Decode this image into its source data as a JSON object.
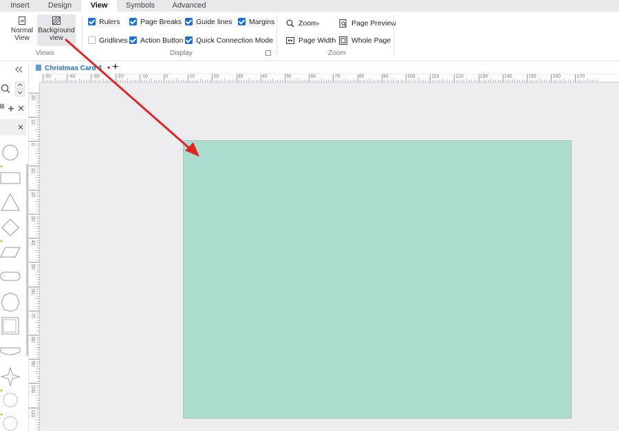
{
  "tabs": [
    {
      "label": "Insert",
      "active": false
    },
    {
      "label": "Design",
      "active": false
    },
    {
      "label": "View",
      "active": true
    },
    {
      "label": "Symbols",
      "active": false
    },
    {
      "label": "Advanced",
      "active": false
    }
  ],
  "views": {
    "group_label": "Views",
    "normal_view": "Normal\nView",
    "background_view": "Background\nview"
  },
  "display": {
    "group_label": "Display",
    "rulers": {
      "label": "Rulers",
      "checked": true
    },
    "page_breaks": {
      "label": "Page Breaks",
      "checked": true
    },
    "guide_lines": {
      "label": "Guide lines",
      "checked": true
    },
    "margins": {
      "label": "Margins",
      "checked": true
    },
    "gridlines": {
      "label": "Gridlines",
      "checked": false
    },
    "action_button": {
      "label": "Action Button",
      "checked": true
    },
    "quick_connection": {
      "label": "Quick Connection Mode",
      "checked": true
    }
  },
  "zoom": {
    "group_label": "Zoom",
    "zoom": "Zoom",
    "page_width": "Page Width",
    "page_preview": "Page Preview",
    "whole_page": "Whole Page"
  },
  "document": {
    "tab_title": "Christmas Card 4",
    "modified_marker": "•",
    "add_tab": "+"
  },
  "ruler": {
    "horizontal": [
      "-50",
      "-40",
      "-30",
      "-20",
      "-10",
      "0",
      "10",
      "20",
      "30",
      "40",
      "50",
      "60",
      "70",
      "80",
      "90",
      "100",
      "110",
      "120",
      "130",
      "140",
      "150",
      "160",
      "170"
    ],
    "vertical": [
      "20",
      "10",
      "0",
      "10",
      "20",
      "30",
      "40",
      "50",
      "60",
      "70",
      "80",
      "90",
      "100",
      "110"
    ]
  },
  "colors": {
    "page_background": "#acdbcf",
    "accent": "#1e6fd0",
    "annotation_arrow": "#e02424"
  },
  "icons": [
    "collapse-icon",
    "search-icon",
    "chevron-up-icon",
    "chevron-down-icon",
    "add-icon",
    "close-icon",
    "zoom-icon",
    "page-width-icon",
    "page-preview-icon",
    "whole-page-icon"
  ]
}
